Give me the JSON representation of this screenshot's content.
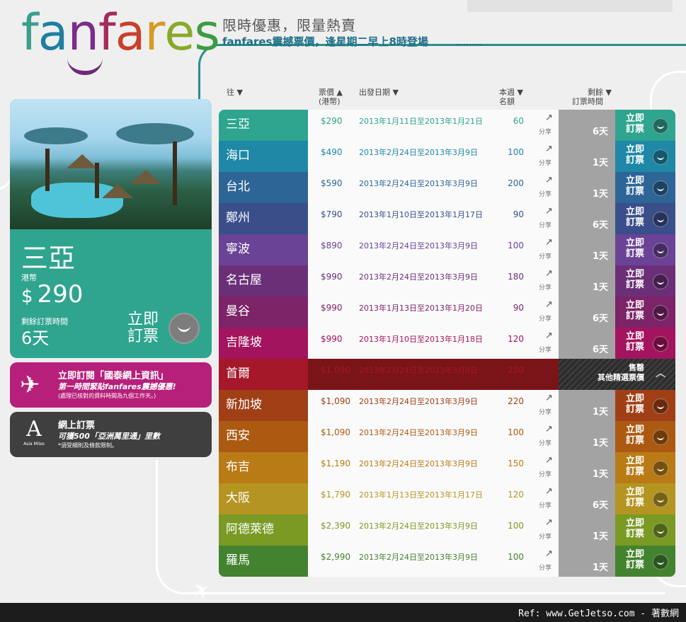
{
  "logo": {
    "letters": [
      {
        "ch": "f",
        "color": "#3aa08c"
      },
      {
        "ch": "a",
        "color": "#1e7fa0"
      },
      {
        "ch": "n",
        "color": "#7a2c8a"
      },
      {
        "ch": "f",
        "color": "#a42c5d"
      },
      {
        "ch": "a",
        "color": "#c9402a"
      },
      {
        "ch": "r",
        "color": "#d89a22"
      },
      {
        "ch": "e",
        "color": "#88a92a"
      },
      {
        "ch": "s",
        "color": "#3d9c44"
      }
    ]
  },
  "header": {
    "title": "限時優惠，限量熱賣",
    "subtitle": "fanfares震撼票價，逢星期二早上8時登場"
  },
  "featured": {
    "city": "三亞",
    "currency_label": "港幣",
    "currency_symbol": "$",
    "price": "290",
    "remain_label": "剩餘訂票時間",
    "remain": "6天",
    "book_label": "立即訂票"
  },
  "promos": {
    "subscribe_title": "立即訂閱「國泰網上資訊」",
    "subscribe_line": "第一時間緊貼fanfares震撼優惠!",
    "subscribe_note": "(處理已核對的資料時間為九個工作天。)",
    "plane_icon": "plane-icon",
    "online_title": "網上訂票",
    "online_line": "可獲500「亞洲萬里通」里數",
    "online_note": "*須受細則及條款限制。",
    "asia_miles_letter": "A",
    "asia_miles_text": "Asia Miles"
  },
  "table_headers": {
    "dest": "往 ▼",
    "fare": "票價 ▲",
    "fare_unit": "(港幣)",
    "date": "出發日期 ▼",
    "quota_1": "本週 ▼",
    "quota_2": "名額",
    "remain_1": "剩餘 ▼",
    "remain_2": "訂票時間"
  },
  "row_labels": {
    "share": "分享",
    "book": "立即訂票"
  },
  "rows": [
    {
      "city": "三亞",
      "price": "$290",
      "dates": "2013年1月11日至2013年1月21日",
      "quota": "60",
      "remain": "6天",
      "color": "#2fa48f"
    },
    {
      "city": "海口",
      "price": "$490",
      "dates": "2013年2月24日至2013年3月9日",
      "quota": "100",
      "remain": "1天",
      "color": "#1e88a6"
    },
    {
      "city": "台北",
      "price": "$590",
      "dates": "2013年2月24日至2013年3月9日",
      "quota": "200",
      "remain": "1天",
      "color": "#2d6596"
    },
    {
      "city": "鄭州",
      "price": "$790",
      "dates": "2013年1月10日至2013年1月17日",
      "quota": "90",
      "remain": "6天",
      "color": "#3a4e8a"
    },
    {
      "city": "寧波",
      "price": "$890",
      "dates": "2013年2月24日至2013年3月9日",
      "quota": "100",
      "remain": "1天",
      "color": "#6a4396"
    },
    {
      "city": "名古屋",
      "price": "$990",
      "dates": "2013年2月24日至2013年3月9日",
      "quota": "180",
      "remain": "1天",
      "color": "#6b2f78"
    },
    {
      "city": "曼谷",
      "price": "$990",
      "dates": "2013年1月13日至2013年1月20日",
      "quota": "90",
      "remain": "6天",
      "color": "#7d2468"
    },
    {
      "city": "吉隆坡",
      "price": "$990",
      "dates": "2013年1月10日至2013年1月18日",
      "quota": "120",
      "remain": "6天",
      "color": "#a3145e"
    },
    {
      "city": "首爾",
      "price": "$1,090",
      "dates": "2013年2月24日至2013年3月9日",
      "quota": "250",
      "remain": "",
      "color": "#a5182a",
      "sold_out": true,
      "sold_label": "售罄",
      "sold_more": "其他精選票價"
    },
    {
      "city": "新加坡",
      "price": "$1,090",
      "dates": "2013年2月24日至2013年3月9日",
      "quota": "220",
      "remain": "1天",
      "color": "#a03f16"
    },
    {
      "city": "西安",
      "price": "$1,090",
      "dates": "2013年2月24日至2013年3月9日",
      "quota": "100",
      "remain": "1天",
      "color": "#ac5a12"
    },
    {
      "city": "布吉",
      "price": "$1,190",
      "dates": "2013年2月24日至2013年3月9日",
      "quota": "150",
      "remain": "1天",
      "color": "#b97b16"
    },
    {
      "city": "大阪",
      "price": "$1,790",
      "dates": "2013年1月13日至2013年1月17日",
      "quota": "120",
      "remain": "6天",
      "color": "#b59522"
    },
    {
      "city": "阿德萊德",
      "price": "$2,390",
      "dates": "2013年2月24日至2013年3月9日",
      "quota": "100",
      "remain": "1天",
      "color": "#7a9a24"
    },
    {
      "city": "羅馬",
      "price": "$2,990",
      "dates": "2013年2月24日至2013年3月9日",
      "quota": "100",
      "remain": "1天",
      "color": "#43832f"
    }
  ],
  "footer": {
    "ref": "Ref: www.GetJetso.com - 著數網"
  }
}
